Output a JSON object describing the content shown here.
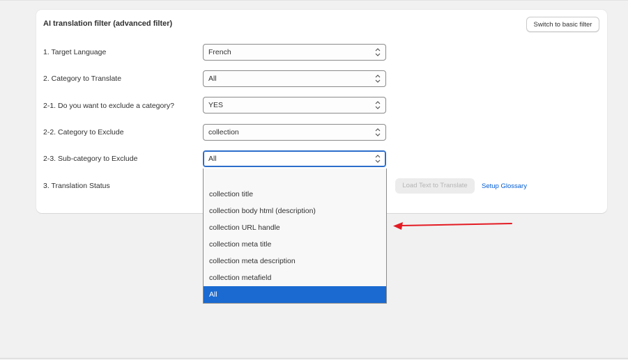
{
  "card": {
    "title": "AI translation filter (advanced filter)",
    "switch_label": "Switch to basic filter"
  },
  "rows": [
    {
      "label": "1. Target Language",
      "value": "French"
    },
    {
      "label": "2. Category to Translate",
      "value": "All"
    },
    {
      "label": "2-1. Do you want to exclude a category?",
      "value": "YES"
    },
    {
      "label": "2-2. Category to Exclude",
      "value": "collection"
    },
    {
      "label": "2-3. Sub-category to Exclude",
      "value": "All"
    },
    {
      "label": "3. Translation Status"
    }
  ],
  "actions": {
    "load_text": "Load Text to Translate",
    "setup_glossary": "Setup Glossary"
  },
  "dropdown": {
    "options": [
      "",
      "collection title",
      "collection body html (description)",
      "collection URL handle",
      "collection meta title",
      "collection meta description",
      "collection metafield",
      "All"
    ],
    "selected": "All"
  },
  "colors": {
    "accent": "#2c6ecb",
    "selected_option": "#1a6ad1",
    "link": "#005bd3",
    "annotation_arrow": "#e31b23"
  }
}
